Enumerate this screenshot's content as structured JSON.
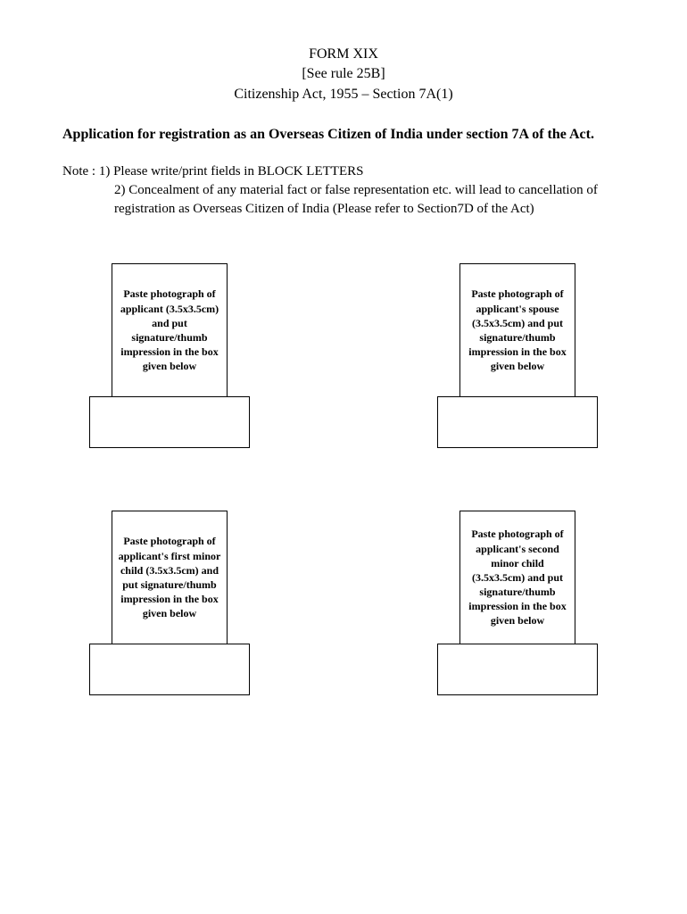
{
  "header": {
    "line1": "FORM XIX",
    "line2": "[See rule 25B]",
    "line3": "Citizenship Act, 1955 – Section 7A(1)"
  },
  "title": "Application for registration as an Overseas Citizen of India under section 7A of the Act.",
  "note": {
    "prefix": "Note : ",
    "item1": "1) Please write/print fields in BLOCK LETTERS",
    "item2": "2) Concealment of any material fact or false representation etc. will lead to cancellation of registration as Overseas Citizen of India (Please refer to Section7D of the Act)"
  },
  "photos": {
    "applicant": "Paste photograph of applicant (3.5x3.5cm) and put signature/thumb impression in the box given below",
    "spouse": "Paste photograph of applicant's spouse (3.5x3.5cm) and put signature/thumb impression in the box given below",
    "child1": "Paste photograph of applicant's first minor child (3.5x3.5cm) and put signature/thumb impression in the box given below",
    "child2": "Paste photograph of applicant's second minor child (3.5x3.5cm) and put signature/thumb impression in the box given  below"
  }
}
